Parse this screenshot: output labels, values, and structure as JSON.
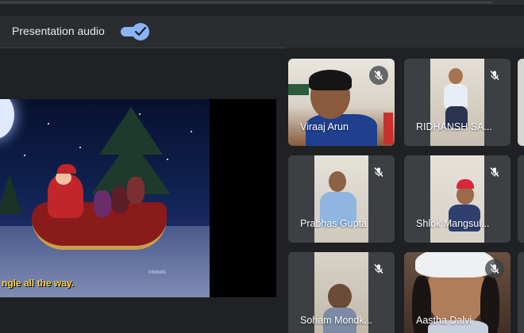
{
  "presentation_audio": {
    "label": "Presentation audio",
    "enabled": true,
    "toggle_color": "#8ab4f8"
  },
  "presentation": {
    "lyrics": "ngle all the way.",
    "watermark": "infobells"
  },
  "participants": [
    {
      "name": "Viraaj Arun",
      "muted": true
    },
    {
      "name": "RIDHANSH SA...",
      "muted": true
    },
    {
      "name": "Prabhas Gupta",
      "muted": true
    },
    {
      "name": "Shlok Mangsul...",
      "muted": true
    },
    {
      "name": "Soham Mondk...",
      "muted": true
    },
    {
      "name": "Aastha Dalvi",
      "muted": true
    }
  ],
  "icons": {
    "toggle_check": "check-icon",
    "tile_status": "mic-off-icon"
  }
}
